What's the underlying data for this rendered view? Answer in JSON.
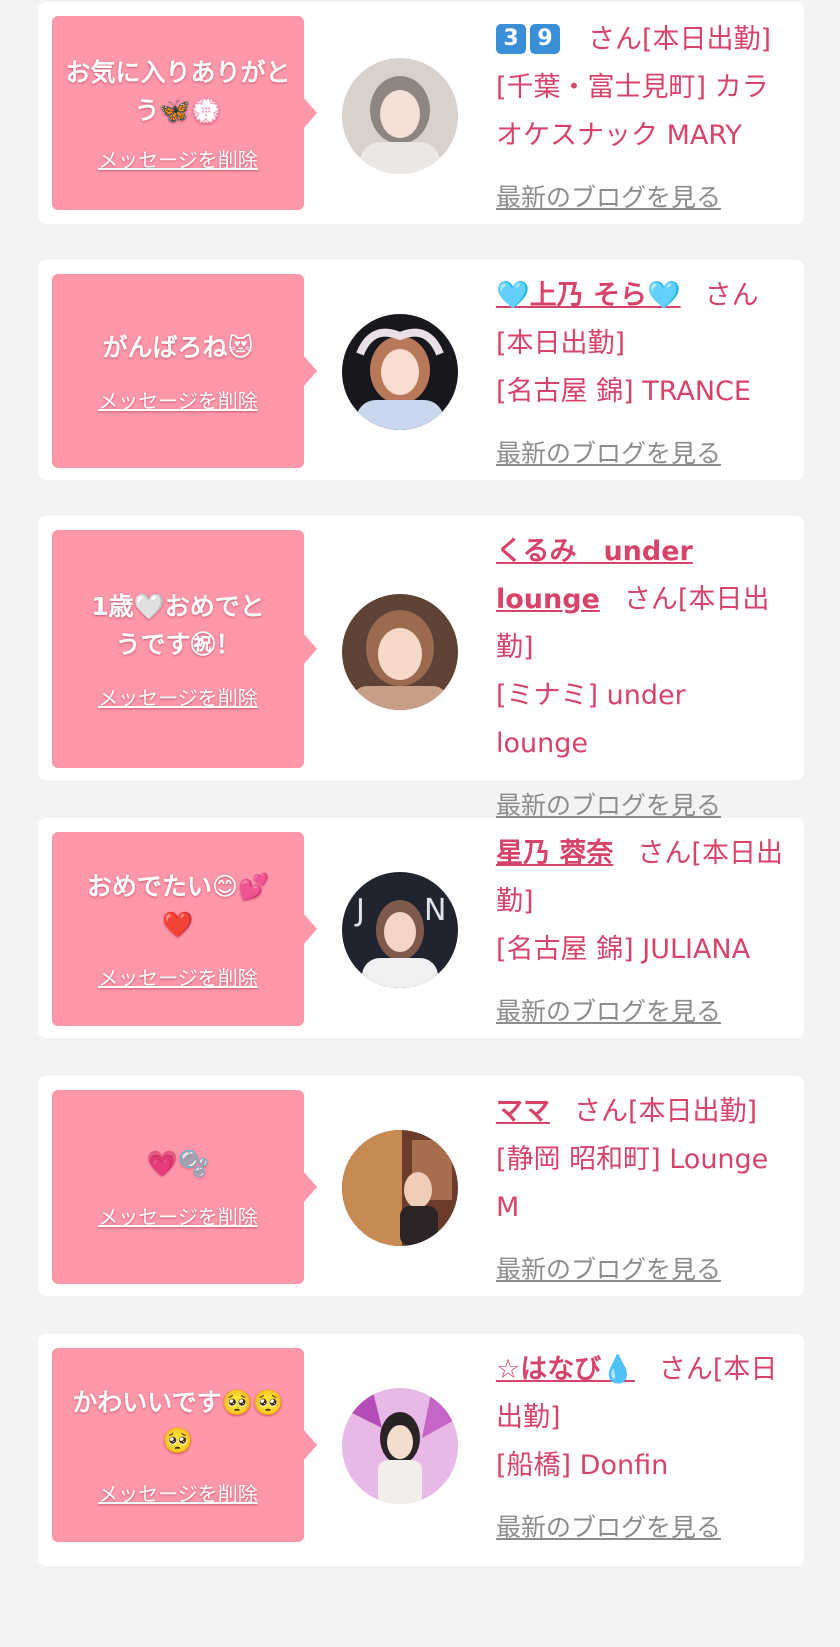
{
  "cards": [
    {
      "message": "お気に入りありがとう🦋💮",
      "delete_label": "メッセージを削除",
      "name": "",
      "name_badges": [
        "3",
        "9"
      ],
      "san": "さん[本日出勤]",
      "store": "[千葉・富士見町] カラオケスナック MARY",
      "blog_label": "最新のブログを見る",
      "avatar_icon": "avatar-photo-woman"
    },
    {
      "message": "がんばろね😻",
      "delete_label": "メッセージを削除",
      "name": "🩵上乃 そら🩵",
      "san": "さん",
      "status": "[本日出勤]",
      "store": "[名古屋 錦] TRANCE",
      "blog_label": "最新のブログを見る",
      "avatar_icon": "avatar-photo-woman"
    },
    {
      "message": "1歳🤍おめでとうです㊗！",
      "delete_label": "メッセージを削除",
      "name": "くるみ　under lounge",
      "san": "さん[本日出勤]",
      "store": "[ミナミ] under lounge",
      "blog_label": "最新のブログを見る",
      "avatar_icon": "avatar-photo-woman"
    },
    {
      "message": "おめでたい😊💕❤️",
      "delete_label": "メッセージを削除",
      "name": "星乃 蓉奈",
      "san": "さん[本日出勤]",
      "store": "[名古屋 錦] JULIANA",
      "blog_label": "最新のブログを見る",
      "avatar_icon": "avatar-photo-woman"
    },
    {
      "message": "💗🫧",
      "delete_label": "メッセージを削除",
      "name": "ママ",
      "san": "さん[本日出勤]",
      "store": "[静岡 昭和町] Lounge M",
      "blog_label": "最新のブログを見る",
      "avatar_icon": "avatar-photo-woman"
    },
    {
      "message": "かわいいです🥺🥺🥺",
      "delete_label": "メッセージを削除",
      "name": "☆はなび💧",
      "san": "さん[本日出勤]",
      "store": "[船橋] Donfin",
      "blog_label": "最新のブログを見る",
      "avatar_icon": "avatar-photo-woman"
    }
  ],
  "colors": {
    "bubble": "#ff97ab",
    "accent_text": "#d8436a",
    "blog_link": "#8c8c8c",
    "page_bg": "#f3f3f3"
  }
}
